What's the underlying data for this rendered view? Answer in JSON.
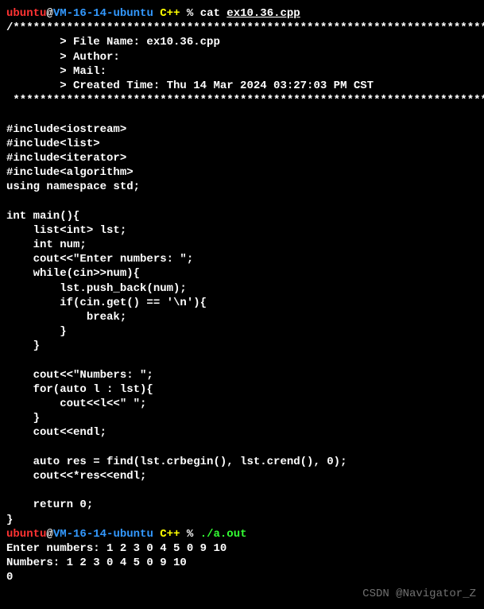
{
  "prompt1": {
    "user": "ubuntu",
    "at": "@",
    "host": "VM-16-14-ubuntu",
    "dir": " C++ ",
    "percent": "% ",
    "cmd": "cat ",
    "arg": "ex10.36.cpp"
  },
  "code": "/*************************************************************************\n        > File Name: ex10.36.cpp\n        > Author:\n        > Mail:\n        > Created Time: Thu 14 Mar 2024 03:27:03 PM CST\n ************************************************************************/\n\n#include<iostream>\n#include<list>\n#include<iterator>\n#include<algorithm>\nusing namespace std;\n\nint main(){\n    list<int> lst;\n    int num;\n    cout<<\"Enter numbers: \";\n    while(cin>>num){\n        lst.push_back(num);\n        if(cin.get() == '\\n'){\n            break;\n        }\n    }\n\n    cout<<\"Numbers: \";\n    for(auto l : lst){\n        cout<<l<<\" \";\n    }\n    cout<<endl;\n\n    auto res = find(lst.crbegin(), lst.crend(), 0);\n    cout<<*res<<endl;\n\n    return 0;\n}",
  "prompt2": {
    "user": "ubuntu",
    "at": "@",
    "host": "VM-16-14-ubuntu",
    "dir": " C++ ",
    "percent": "% ",
    "cmd": "./a.out"
  },
  "output": "Enter numbers: 1 2 3 0 4 5 0 9 10\nNumbers: 1 2 3 0 4 5 0 9 10\n0",
  "watermark": "CSDN @Navigator_Z"
}
